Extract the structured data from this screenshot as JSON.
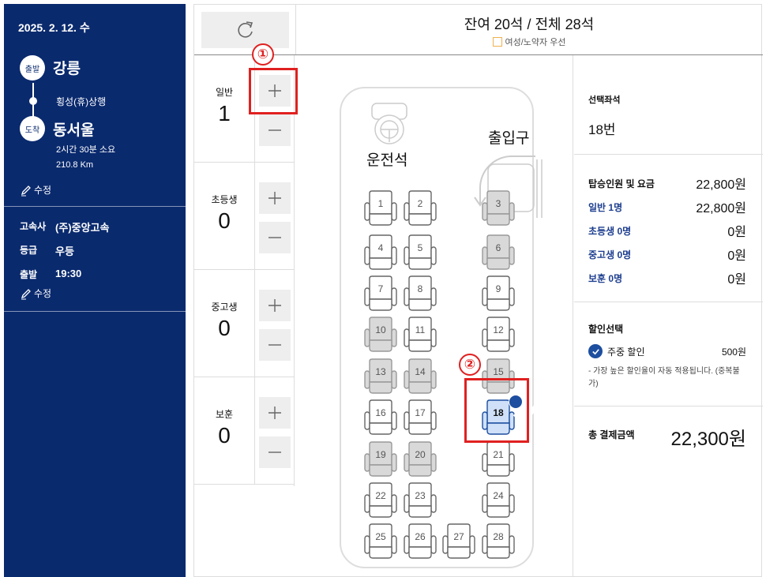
{
  "sidebar": {
    "date": "2025. 2. 12. 수",
    "departure_badge": "출발",
    "departure_city": "강릉",
    "via": "횡성(휴)상행",
    "arrival_badge": "도착",
    "arrival_city": "동서울",
    "duration": "2시간 30분 소요",
    "distance": "210.8 Km",
    "edit_label": "수정",
    "company_key": "고속사",
    "company_value": "(주)중앙고속",
    "grade_key": "등급",
    "grade_value": "우등",
    "depart_key": "출발",
    "depart_time": "19:30",
    "edit_label_2": "수정"
  },
  "header": {
    "title": "잔여 20석 / 전체 28석",
    "legend_label": "여성/노약자 우선"
  },
  "passengers": [
    {
      "label": "일반",
      "count": "1"
    },
    {
      "label": "초등생",
      "count": "0"
    },
    {
      "label": "중고생",
      "count": "0"
    },
    {
      "label": "보훈",
      "count": "0"
    }
  ],
  "callouts": {
    "one": "①",
    "two": "②"
  },
  "bus": {
    "driver_label": "운전석",
    "entrance_label": "출입구",
    "seats": [
      {
        "num": "1",
        "state": "available"
      },
      {
        "num": "2",
        "state": "available"
      },
      {
        "num": "3",
        "state": "sold"
      },
      {
        "num": "4",
        "state": "available"
      },
      {
        "num": "5",
        "state": "available"
      },
      {
        "num": "6",
        "state": "sold"
      },
      {
        "num": "7",
        "state": "available"
      },
      {
        "num": "8",
        "state": "available"
      },
      {
        "num": "9",
        "state": "available"
      },
      {
        "num": "10",
        "state": "sold"
      },
      {
        "num": "11",
        "state": "available"
      },
      {
        "num": "12",
        "state": "available"
      },
      {
        "num": "13",
        "state": "sold"
      },
      {
        "num": "14",
        "state": "sold"
      },
      {
        "num": "15",
        "state": "sold"
      },
      {
        "num": "16",
        "state": "available"
      },
      {
        "num": "17",
        "state": "available"
      },
      {
        "num": "18",
        "state": "selected"
      },
      {
        "num": "19",
        "state": "sold"
      },
      {
        "num": "20",
        "state": "sold"
      },
      {
        "num": "21",
        "state": "available"
      },
      {
        "num": "22",
        "state": "available"
      },
      {
        "num": "23",
        "state": "available"
      },
      {
        "num": "24",
        "state": "available"
      },
      {
        "num": "25",
        "state": "available"
      },
      {
        "num": "26",
        "state": "available"
      },
      {
        "num": "27",
        "state": "available"
      },
      {
        "num": "28",
        "state": "available"
      }
    ]
  },
  "summary": {
    "selected_seat_title": "선택좌석",
    "selected_seat_value": "18번",
    "fare_title": "탑승인원 및 요금",
    "fare_total": "22,800원",
    "rows": [
      {
        "label": "일반 1명",
        "value": "22,800원"
      },
      {
        "label": "초등생 0명",
        "value": "0원"
      },
      {
        "label": "중고생 0명",
        "value": "0원"
      },
      {
        "label": "보훈 0명",
        "value": "0원"
      }
    ],
    "discount_title": "할인선택",
    "discount_label": "주중 할인",
    "discount_amount": "500원",
    "discount_note": "- 가장 높은 할인율이 자동 적용됩니다. (중복불가)",
    "total_label": "총 결제금액",
    "total_value": "22,300원"
  },
  "colors": {
    "navy": "#0a2a6e",
    "selected_seat": "#cfe0f8",
    "sold_seat": "#d9d9d9",
    "callout_red": "#e02020",
    "priority_legend": "#f0b050"
  }
}
